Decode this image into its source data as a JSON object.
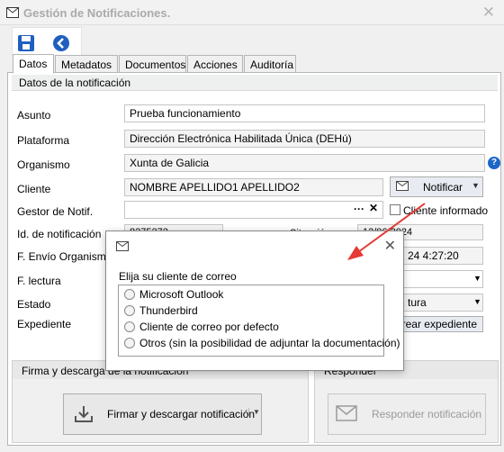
{
  "window": {
    "title": "Gestión de Notificaciones."
  },
  "tabs": [
    "Datos",
    "Metadatos",
    "Documentos",
    "Acciones",
    "Auditoría"
  ],
  "group_title": "Datos de la notificación",
  "fields": {
    "asunto": {
      "label": "Asunto",
      "value": "Prueba funcionamiento"
    },
    "plataforma": {
      "label": "Plataforma",
      "value": "Dirección Electrónica Habilitada Única (DEHú)"
    },
    "organismo": {
      "label": "Organismo",
      "value": "Xunta de Galicia"
    },
    "cliente": {
      "label": "Cliente",
      "value": "NOMBRE APELLIDO1 APELLIDO2"
    },
    "gestor": {
      "label": "Gestor de Notif.",
      "value": ""
    },
    "id": {
      "label": "Id. de notificación",
      "value": "8275272"
    },
    "fenvio": {
      "label": "F. Envío Organismo",
      "value": ""
    },
    "flectura": {
      "label": "F. lectura",
      "value": ""
    },
    "estado": {
      "label": "Estado",
      "value": ""
    },
    "expediente": {
      "label": "Expediente",
      "value": ""
    }
  },
  "partial": {
    "situacion_label": "Situación",
    "date1": "12/06/2024",
    "date2": "24 4:27:20",
    "estado_right": "tura"
  },
  "buttons": {
    "notificar": "Notificar",
    "cliente_informado": "Cliente informado",
    "crear_expediente": "Crear expediente",
    "firmar": "Firmar y descargar notificación",
    "responder": "Responder notificación"
  },
  "bottom": {
    "firma_title": "Firma y descarga de la notificación",
    "responder_title": "Responder"
  },
  "dialog": {
    "prompt": "Elija su cliente de correo",
    "options": [
      "Microsoft Outlook",
      "Thunderbird",
      "Cliente de correo por defecto",
      "Otros (sin la posibilidad de adjuntar la documentación)"
    ]
  },
  "icons": {
    "help": "?"
  },
  "colors": {
    "accent": "#1e66c8",
    "arrow": "#e53935"
  }
}
